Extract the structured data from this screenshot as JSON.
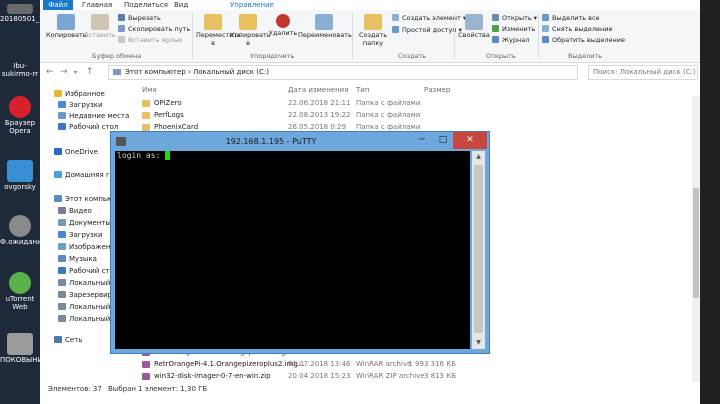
{
  "desktop": {
    "icons": [
      {
        "label": "20180501_1...",
        "color": "#6a6a6a"
      },
      {
        "label": "Ibu-sukirmo-rr",
        "color": "#4a6a8a"
      },
      {
        "label": "Браузер Opera",
        "color": "#d6202a"
      },
      {
        "label": "ovgorsky",
        "color": "#3a8fd4"
      },
      {
        "label": "Ф.ожиданию",
        "color": "#8a8a8a"
      },
      {
        "label": "uTorrent Web",
        "color": "#5ab14a"
      },
      {
        "label": "ПОКОВЫНИ",
        "color": "#9b9b9b"
      }
    ]
  },
  "ribbon_tabs": [
    "Файл",
    "Главная",
    "Поделиться",
    "Вид",
    "Управление"
  ],
  "ribbon": {
    "clipboard": {
      "copy": "Копировать",
      "paste": "Вставить",
      "cut": "Вырезать",
      "copy_path": "Скопировать путь",
      "paste_shortcut": "Вставить ярлык",
      "group": "Буфер обмена"
    },
    "organize": {
      "move_to": "Переместить в",
      "copy_to": "Копировать в",
      "delete": "Удалить",
      "rename": "Переименовать",
      "group": "Упорядочить"
    },
    "create": {
      "new_folder": "Создать папку",
      "new_item": "Создать элемент",
      "easy_access": "Простой доступ",
      "group": "Создать"
    },
    "open": {
      "properties": "Свойства",
      "open": "Открыть",
      "edit": "Изменить",
      "history": "Журнал",
      "group": "Открыть"
    },
    "select": {
      "select_all": "Выделить все",
      "select_none": "Снять выделение",
      "invert": "Обратить выделение",
      "group": "Выделить"
    }
  },
  "address": {
    "path": "Этот компьютер › Локальный диск (C:)",
    "search_placeholder": "Поиск: Локальный диск (C:)"
  },
  "nav": [
    {
      "label": "Избранное",
      "color": "#e8b830"
    },
    {
      "label": "Загрузки",
      "color": "#4a8ad4"
    },
    {
      "label": "Недавние места",
      "color": "#6a9acb"
    },
    {
      "label": "Рабочий стол",
      "color": "#3a7ac4"
    },
    {
      "label": "OneDrive",
      "color": "#2a6acb"
    },
    {
      "label": "Домашняя группа",
      "color": "#4aa0d8"
    },
    {
      "label": "Этот компьютер",
      "color": "#5a8aba"
    },
    {
      "label": "Видео",
      "color": "#7a7a9a"
    },
    {
      "label": "Документы",
      "color": "#7a9aba"
    },
    {
      "label": "Загрузки",
      "color": "#4a8ad4"
    },
    {
      "label": "Изображения",
      "color": "#6aa0c0"
    },
    {
      "label": "Музыка",
      "color": "#5a8abf"
    },
    {
      "label": "Рабочий сто",
      "color": "#3a7ac4"
    },
    {
      "label": "Локальный д",
      "color": "#7a8a9a"
    },
    {
      "label": "Зарезервиро",
      "color": "#7a8a9a"
    },
    {
      "label": "Локальный д",
      "color": "#7a8a9a"
    },
    {
      "label": "Локальный д",
      "color": "#7a8a9a"
    },
    {
      "label": "Сеть",
      "color": "#4a7aaa"
    }
  ],
  "columns": {
    "name": "Имя",
    "date": "Дата изменения",
    "type": "Тип",
    "size": "Размер"
  },
  "files": [
    {
      "name": "OPiZero",
      "date": "22.06.2018 21:11",
      "type": "Папка с файлами",
      "size": "",
      "color": "#e8c060"
    },
    {
      "name": "PerfLogs",
      "date": "22.08.2013 19:22",
      "type": "Папка с файлами",
      "size": "",
      "color": "#e8c060"
    },
    {
      "name": "PhoenixCard",
      "date": "26.05.2018 0:29",
      "type": "Папка с файлами",
      "size": "",
      "color": "#e8c060"
    }
  ],
  "files_bottom": [
    {
      "name": "RetrOrangePi-3.0.1.Orangepizero.img.tar...",
      "date": "01.07.2018 13:44",
      "type": "WinRAR archive",
      "size": "1 312 639 КБ",
      "color": "#9a5a9a"
    },
    {
      "name": "RetrOrangePi-4.1.Orangepizeroplus2.img...",
      "date": "01.07.2018 13:46",
      "type": "WinRAR archive",
      "size": "1 993 316 КБ",
      "color": "#9a5a9a"
    },
    {
      "name": "win32-disk-imager-0-7-en-win.zip",
      "date": "20.04.2018 15:23",
      "type": "WinRAR ZIP archive",
      "size": "3 813 КБ",
      "color": "#9a5a9a"
    }
  ],
  "status": {
    "count": "Элементов: 37",
    "selected": "Выбран 1 элемент: 1,30 ГБ"
  },
  "putty": {
    "title": "192.168.1.195 - PuTTY",
    "prompt": "login as: ",
    "minimize": "─",
    "maximize": "□",
    "close": "✕"
  }
}
